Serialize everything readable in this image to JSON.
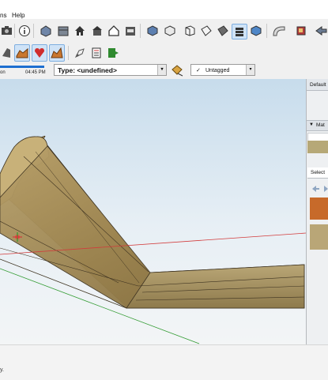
{
  "menubar": {
    "items": [
      "ns",
      "Help"
    ]
  },
  "shadows": {
    "time_start": "on",
    "time_end": "04:45 PM"
  },
  "entity_info": {
    "type_label": "Type: <undefined>",
    "tag_value": "Untagged",
    "dropdown_arrow": "▾"
  },
  "right_panel": {
    "default_tray_title": "Default",
    "materials_header": "Mat",
    "select_tab": "Select"
  },
  "status": {
    "text": "y."
  },
  "icons": [
    "camera-icon",
    "info-icon",
    "component-icon",
    "house-icon",
    "roof-icon",
    "outline-house-icon",
    "box-icon",
    "iso-view-icon",
    "top-view-icon",
    "front-view-icon",
    "right-view-icon",
    "back-view-icon",
    "left-view-icon",
    "xray-icon",
    "wireframe-icon",
    "hidden-line-icon",
    "shaded-icon",
    "textured-icon",
    "monochrome-icon",
    "sandbox-icon",
    "ruby-icon",
    "extension-icon",
    "fog-icon",
    "shadow-toggle-icon",
    "match-photo-icon",
    "dimension-icon",
    "section-icon",
    "export-icon"
  ],
  "colors": {
    "accent": "#1e6fd0",
    "axis_red": "#d23b3b",
    "axis_green": "#2f9a2f",
    "wood": "#a38a55"
  }
}
